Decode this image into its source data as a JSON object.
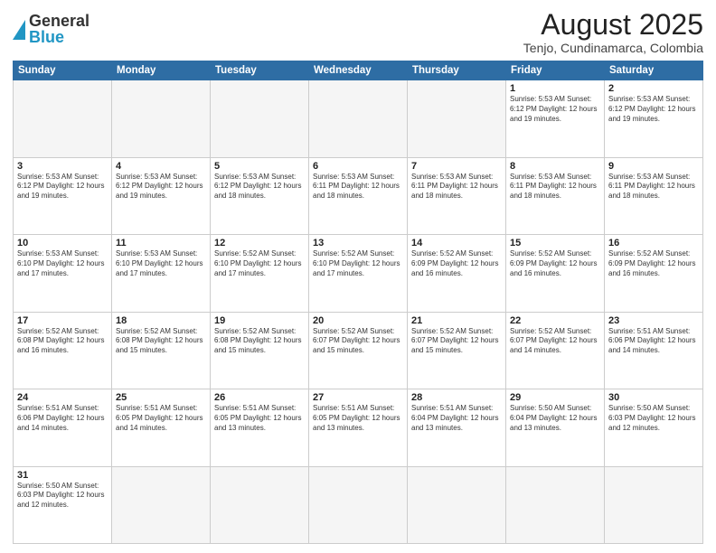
{
  "logo": {
    "text_general": "General",
    "text_blue": "Blue"
  },
  "title": "August 2025",
  "subtitle": "Tenjo, Cundinamarca, Colombia",
  "days_header": [
    "Sunday",
    "Monday",
    "Tuesday",
    "Wednesday",
    "Thursday",
    "Friday",
    "Saturday"
  ],
  "weeks": [
    [
      {
        "day": "",
        "info": "",
        "empty": true
      },
      {
        "day": "",
        "info": "",
        "empty": true
      },
      {
        "day": "",
        "info": "",
        "empty": true
      },
      {
        "day": "",
        "info": "",
        "empty": true
      },
      {
        "day": "",
        "info": "",
        "empty": true
      },
      {
        "day": "1",
        "info": "Sunrise: 5:53 AM\nSunset: 6:12 PM\nDaylight: 12 hours\nand 19 minutes."
      },
      {
        "day": "2",
        "info": "Sunrise: 5:53 AM\nSunset: 6:12 PM\nDaylight: 12 hours\nand 19 minutes."
      }
    ],
    [
      {
        "day": "3",
        "info": "Sunrise: 5:53 AM\nSunset: 6:12 PM\nDaylight: 12 hours\nand 19 minutes."
      },
      {
        "day": "4",
        "info": "Sunrise: 5:53 AM\nSunset: 6:12 PM\nDaylight: 12 hours\nand 19 minutes."
      },
      {
        "day": "5",
        "info": "Sunrise: 5:53 AM\nSunset: 6:12 PM\nDaylight: 12 hours\nand 18 minutes."
      },
      {
        "day": "6",
        "info": "Sunrise: 5:53 AM\nSunset: 6:11 PM\nDaylight: 12 hours\nand 18 minutes."
      },
      {
        "day": "7",
        "info": "Sunrise: 5:53 AM\nSunset: 6:11 PM\nDaylight: 12 hours\nand 18 minutes."
      },
      {
        "day": "8",
        "info": "Sunrise: 5:53 AM\nSunset: 6:11 PM\nDaylight: 12 hours\nand 18 minutes."
      },
      {
        "day": "9",
        "info": "Sunrise: 5:53 AM\nSunset: 6:11 PM\nDaylight: 12 hours\nand 18 minutes."
      }
    ],
    [
      {
        "day": "10",
        "info": "Sunrise: 5:53 AM\nSunset: 6:10 PM\nDaylight: 12 hours\nand 17 minutes."
      },
      {
        "day": "11",
        "info": "Sunrise: 5:53 AM\nSunset: 6:10 PM\nDaylight: 12 hours\nand 17 minutes."
      },
      {
        "day": "12",
        "info": "Sunrise: 5:52 AM\nSunset: 6:10 PM\nDaylight: 12 hours\nand 17 minutes."
      },
      {
        "day": "13",
        "info": "Sunrise: 5:52 AM\nSunset: 6:10 PM\nDaylight: 12 hours\nand 17 minutes."
      },
      {
        "day": "14",
        "info": "Sunrise: 5:52 AM\nSunset: 6:09 PM\nDaylight: 12 hours\nand 16 minutes."
      },
      {
        "day": "15",
        "info": "Sunrise: 5:52 AM\nSunset: 6:09 PM\nDaylight: 12 hours\nand 16 minutes."
      },
      {
        "day": "16",
        "info": "Sunrise: 5:52 AM\nSunset: 6:09 PM\nDaylight: 12 hours\nand 16 minutes."
      }
    ],
    [
      {
        "day": "17",
        "info": "Sunrise: 5:52 AM\nSunset: 6:08 PM\nDaylight: 12 hours\nand 16 minutes."
      },
      {
        "day": "18",
        "info": "Sunrise: 5:52 AM\nSunset: 6:08 PM\nDaylight: 12 hours\nand 15 minutes."
      },
      {
        "day": "19",
        "info": "Sunrise: 5:52 AM\nSunset: 6:08 PM\nDaylight: 12 hours\nand 15 minutes."
      },
      {
        "day": "20",
        "info": "Sunrise: 5:52 AM\nSunset: 6:07 PM\nDaylight: 12 hours\nand 15 minutes."
      },
      {
        "day": "21",
        "info": "Sunrise: 5:52 AM\nSunset: 6:07 PM\nDaylight: 12 hours\nand 15 minutes."
      },
      {
        "day": "22",
        "info": "Sunrise: 5:52 AM\nSunset: 6:07 PM\nDaylight: 12 hours\nand 14 minutes."
      },
      {
        "day": "23",
        "info": "Sunrise: 5:51 AM\nSunset: 6:06 PM\nDaylight: 12 hours\nand 14 minutes."
      }
    ],
    [
      {
        "day": "24",
        "info": "Sunrise: 5:51 AM\nSunset: 6:06 PM\nDaylight: 12 hours\nand 14 minutes."
      },
      {
        "day": "25",
        "info": "Sunrise: 5:51 AM\nSunset: 6:05 PM\nDaylight: 12 hours\nand 14 minutes."
      },
      {
        "day": "26",
        "info": "Sunrise: 5:51 AM\nSunset: 6:05 PM\nDaylight: 12 hours\nand 13 minutes."
      },
      {
        "day": "27",
        "info": "Sunrise: 5:51 AM\nSunset: 6:05 PM\nDaylight: 12 hours\nand 13 minutes."
      },
      {
        "day": "28",
        "info": "Sunrise: 5:51 AM\nSunset: 6:04 PM\nDaylight: 12 hours\nand 13 minutes."
      },
      {
        "day": "29",
        "info": "Sunrise: 5:50 AM\nSunset: 6:04 PM\nDaylight: 12 hours\nand 13 minutes."
      },
      {
        "day": "30",
        "info": "Sunrise: 5:50 AM\nSunset: 6:03 PM\nDaylight: 12 hours\nand 12 minutes."
      }
    ],
    [
      {
        "day": "31",
        "info": "Sunrise: 5:50 AM\nSunset: 6:03 PM\nDaylight: 12 hours\nand 12 minutes."
      },
      {
        "day": "",
        "info": "",
        "empty": true
      },
      {
        "day": "",
        "info": "",
        "empty": true
      },
      {
        "day": "",
        "info": "",
        "empty": true
      },
      {
        "day": "",
        "info": "",
        "empty": true
      },
      {
        "day": "",
        "info": "",
        "empty": true
      },
      {
        "day": "",
        "info": "",
        "empty": true
      }
    ]
  ]
}
